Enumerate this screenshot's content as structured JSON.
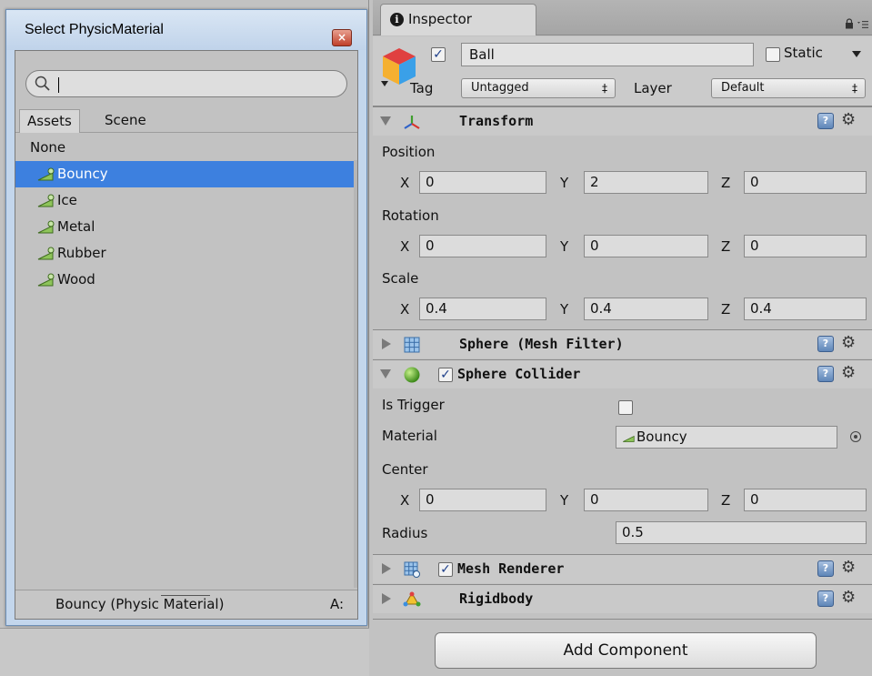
{
  "select_window": {
    "title": "Select PhysicMaterial",
    "close_glyph": "×",
    "search": {
      "value": "",
      "placeholder": ""
    },
    "tabs": [
      {
        "label": "Assets"
      },
      {
        "label": "Scene"
      }
    ],
    "items": [
      {
        "label": "None",
        "icon": ""
      },
      {
        "label": "Bouncy",
        "icon": "physic-material-icon",
        "selected": true
      },
      {
        "label": "Ice",
        "icon": "physic-material-icon"
      },
      {
        "label": "Metal",
        "icon": "physic-material-icon"
      },
      {
        "label": "Rubber",
        "icon": "physic-material-icon"
      },
      {
        "label": "Wood",
        "icon": "physic-material-icon"
      }
    ],
    "preview": {
      "name": "Bouncy (Physic Material)",
      "right": "A:"
    }
  },
  "inspector": {
    "tab_label": "Inspector",
    "tab_icon_glyph": "i",
    "gameobject": {
      "name": "Ball",
      "active": true,
      "static_label": "Static",
      "tag_label": "Tag",
      "tag_value": "Untagged",
      "layer_label": "Layer",
      "layer_value": "Default",
      "dropdown_arrow": "‡"
    },
    "transform": {
      "title": "Transform",
      "position_label": "Position",
      "rotation_label": "Rotation",
      "scale_label": "Scale",
      "axes": {
        "x": "X",
        "y": "Y",
        "z": "Z"
      },
      "position": {
        "x": "0",
        "y": "2",
        "z": "0"
      },
      "rotation": {
        "x": "0",
        "y": "0",
        "z": "0"
      },
      "scale": {
        "x": "0.4",
        "y": "0.4",
        "z": "0.4"
      }
    },
    "mesh_filter": {
      "title": "Sphere (Mesh Filter)"
    },
    "sphere_collider": {
      "title": "Sphere Collider",
      "enabled": true,
      "is_trigger_label": "Is Trigger",
      "is_trigger": false,
      "material_label": "Material",
      "material_value": "Bouncy",
      "center_label": "Center",
      "center": {
        "x": "0",
        "y": "0",
        "z": "0"
      },
      "radius_label": "Radius",
      "radius": "0.5"
    },
    "mesh_renderer": {
      "title": "Mesh Renderer",
      "enabled": true
    },
    "rigidbody": {
      "title": "Rigidbody"
    },
    "help_glyph": "?",
    "gear_glyph": "⚙",
    "check_glyph": "✓",
    "add_component_label": "Add Component"
  },
  "colors": {
    "selection": "#3d80df",
    "panel": "#c2c2c2",
    "window_frame": "#c3d6ec"
  }
}
